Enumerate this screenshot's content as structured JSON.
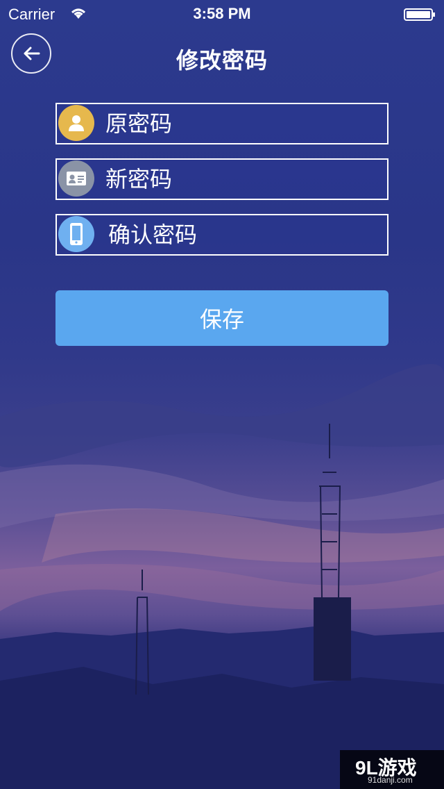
{
  "status_bar": {
    "carrier": "Carrier",
    "time": "3:58 PM",
    "icons": [
      "wifi-icon",
      "battery-icon"
    ]
  },
  "header": {
    "title": "修改密码",
    "back_icon": "arrow-left-icon"
  },
  "form": {
    "fields": [
      {
        "placeholder": "原密码",
        "icon": "user-icon",
        "icon_color": "#e6b84d"
      },
      {
        "placeholder": "新密码",
        "icon": "id-card-icon",
        "icon_color": "#8a93a6"
      },
      {
        "placeholder": "确认密码",
        "icon": "phone-icon",
        "icon_color": "#6fb0f0"
      }
    ],
    "save_label": "保存"
  },
  "colors": {
    "accent": "#5aa7ef"
  },
  "watermark": {
    "brand": "9L游戏",
    "site": "91danji.com"
  }
}
